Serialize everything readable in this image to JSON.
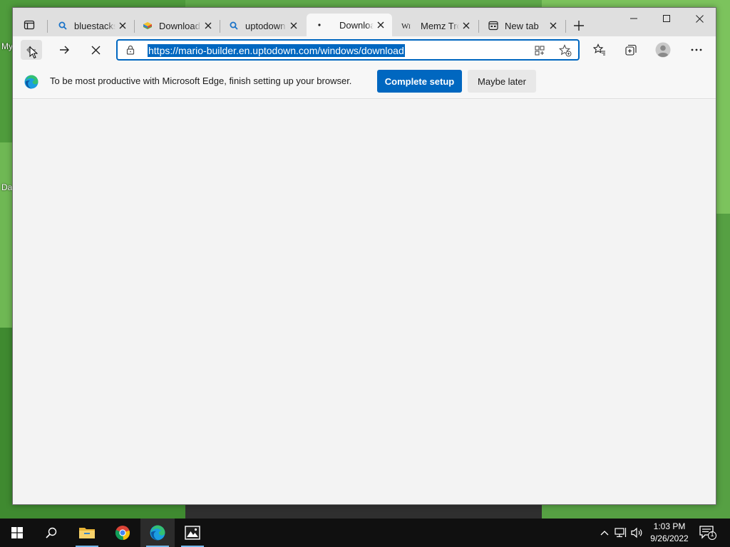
{
  "desktop": {
    "label_1": "My",
    "label_2": "Da"
  },
  "browser": {
    "tabs": [
      {
        "label": "bluestacks",
        "icon": "search-icon"
      },
      {
        "label": "Download",
        "icon": "bluestacks-logo-icon"
      },
      {
        "label": "uptodown",
        "icon": "search-icon"
      },
      {
        "label": "Download",
        "icon": "loading-dot-icon"
      },
      {
        "label": "Memz Tro",
        "icon": "wikipedia-w-icon"
      },
      {
        "label": "New tab",
        "icon": "newtab-page-icon"
      }
    ],
    "active_tab_index": 3,
    "address": {
      "url": "https://mario-builder.en.uptodown.com/windows/download"
    },
    "infobar": {
      "message": "To be most productive with Microsoft Edge, finish setting up your browser.",
      "primary_button": "Complete setup",
      "secondary_button": "Maybe later"
    }
  },
  "taskbar": {
    "time": "1:03 PM",
    "date": "9/26/2022",
    "notification_count": "1"
  },
  "colors": {
    "accent": "#0067c0",
    "desktop_green": "#5fa94a",
    "taskbar": "#101010"
  }
}
